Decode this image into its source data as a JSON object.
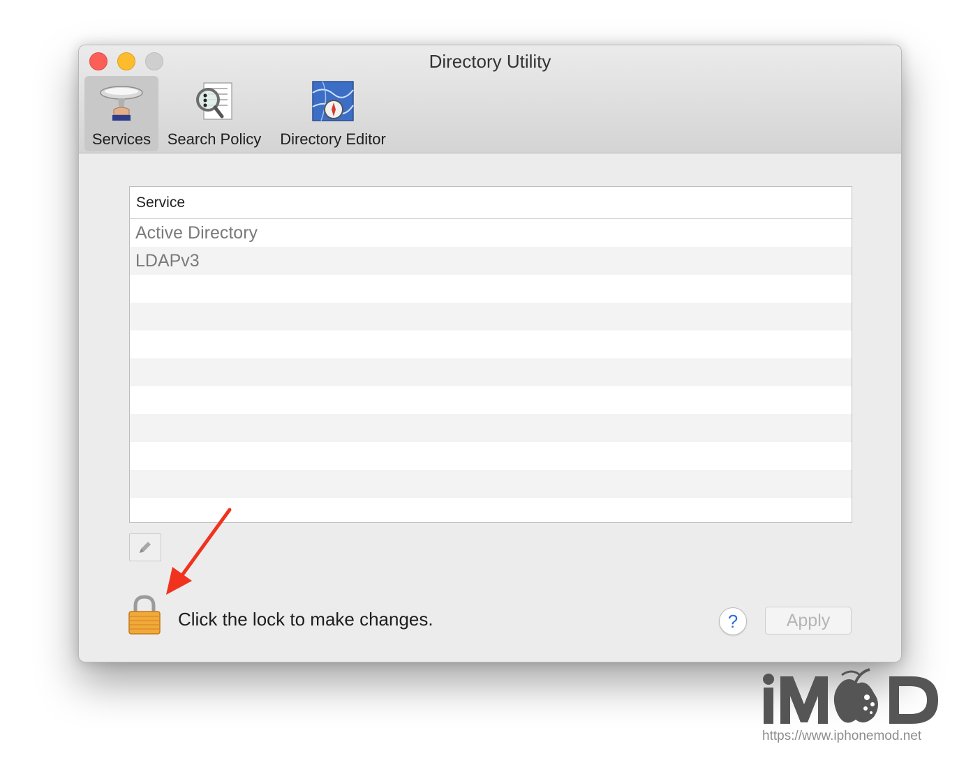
{
  "window": {
    "title": "Directory Utility"
  },
  "toolbar": {
    "items": [
      {
        "label": "Services",
        "icon": "services-icon",
        "selected": true
      },
      {
        "label": "Search Policy",
        "icon": "search-policy-icon",
        "selected": false
      },
      {
        "label": "Directory Editor",
        "icon": "directory-editor-icon",
        "selected": false
      }
    ]
  },
  "services_table": {
    "header": "Service",
    "rows": [
      "Active Directory",
      "LDAPv3",
      "",
      "",
      "",
      "",
      "",
      "",
      "",
      "",
      ""
    ]
  },
  "footer": {
    "lock_text": "Click the lock to make changes.",
    "help_label": "?",
    "apply_label": "Apply"
  },
  "watermark": {
    "url": "https://www.iphonemod.net"
  },
  "colors": {
    "close": "#fc5f57",
    "minimize": "#fdbc2e",
    "zoom": "#cfcfcf",
    "arrow": "#f0321e",
    "lock": "#f2a93b",
    "help": "#2a6fd6"
  }
}
